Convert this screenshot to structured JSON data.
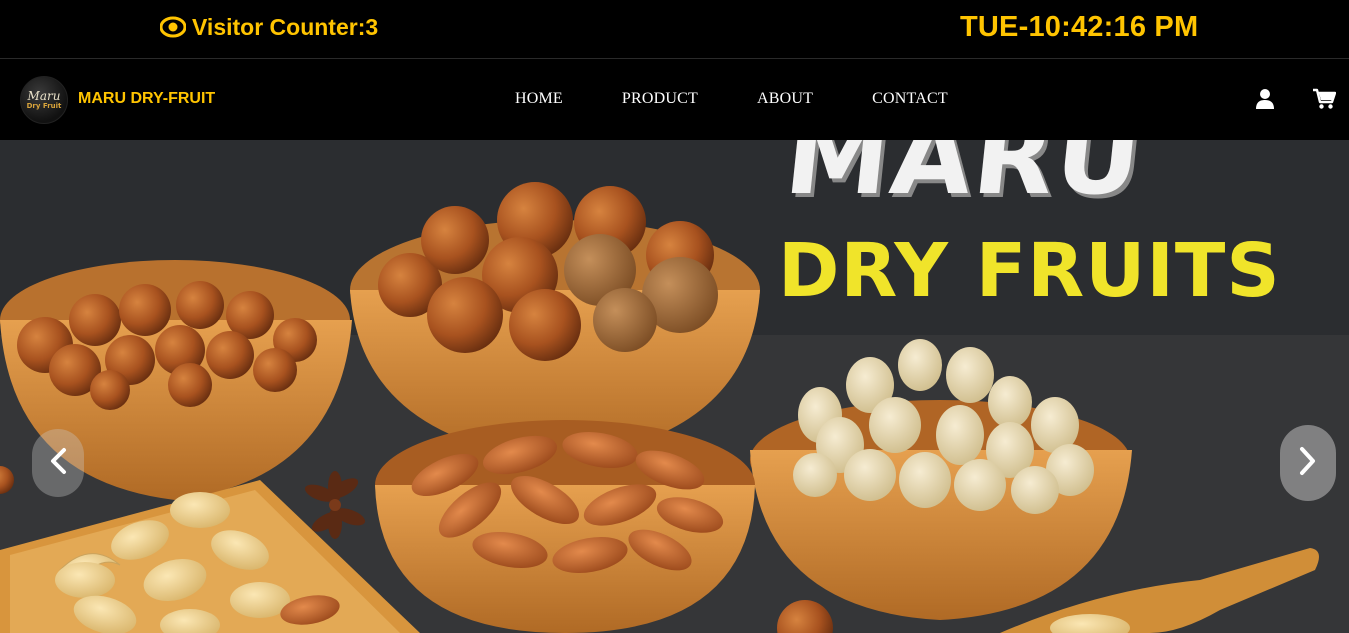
{
  "topbar": {
    "visitor_counter": "Visitor Counter:3",
    "clock": "TUE-10:42:16 PM"
  },
  "brand": {
    "logo_line1": "Maru",
    "logo_line2": "Dry Fruit",
    "name": "MARU DRY-FRUIT"
  },
  "nav": {
    "items": [
      {
        "label": "HOME"
      },
      {
        "label": "PRODUCT"
      },
      {
        "label": "ABOUT"
      },
      {
        "label": "CONTACT"
      }
    ]
  },
  "icons": {
    "visitor": "eye-icon",
    "user": "user-icon",
    "cart": "cart-icon",
    "prev": "chevron-left-icon",
    "next": "chevron-right-icon"
  },
  "hero": {
    "title_line1": "MARU",
    "title_line2": "DRY FRUITS"
  },
  "colors": {
    "accent": "#ffc400",
    "background": "#000000",
    "hero_yellow": "#f0e42a"
  }
}
